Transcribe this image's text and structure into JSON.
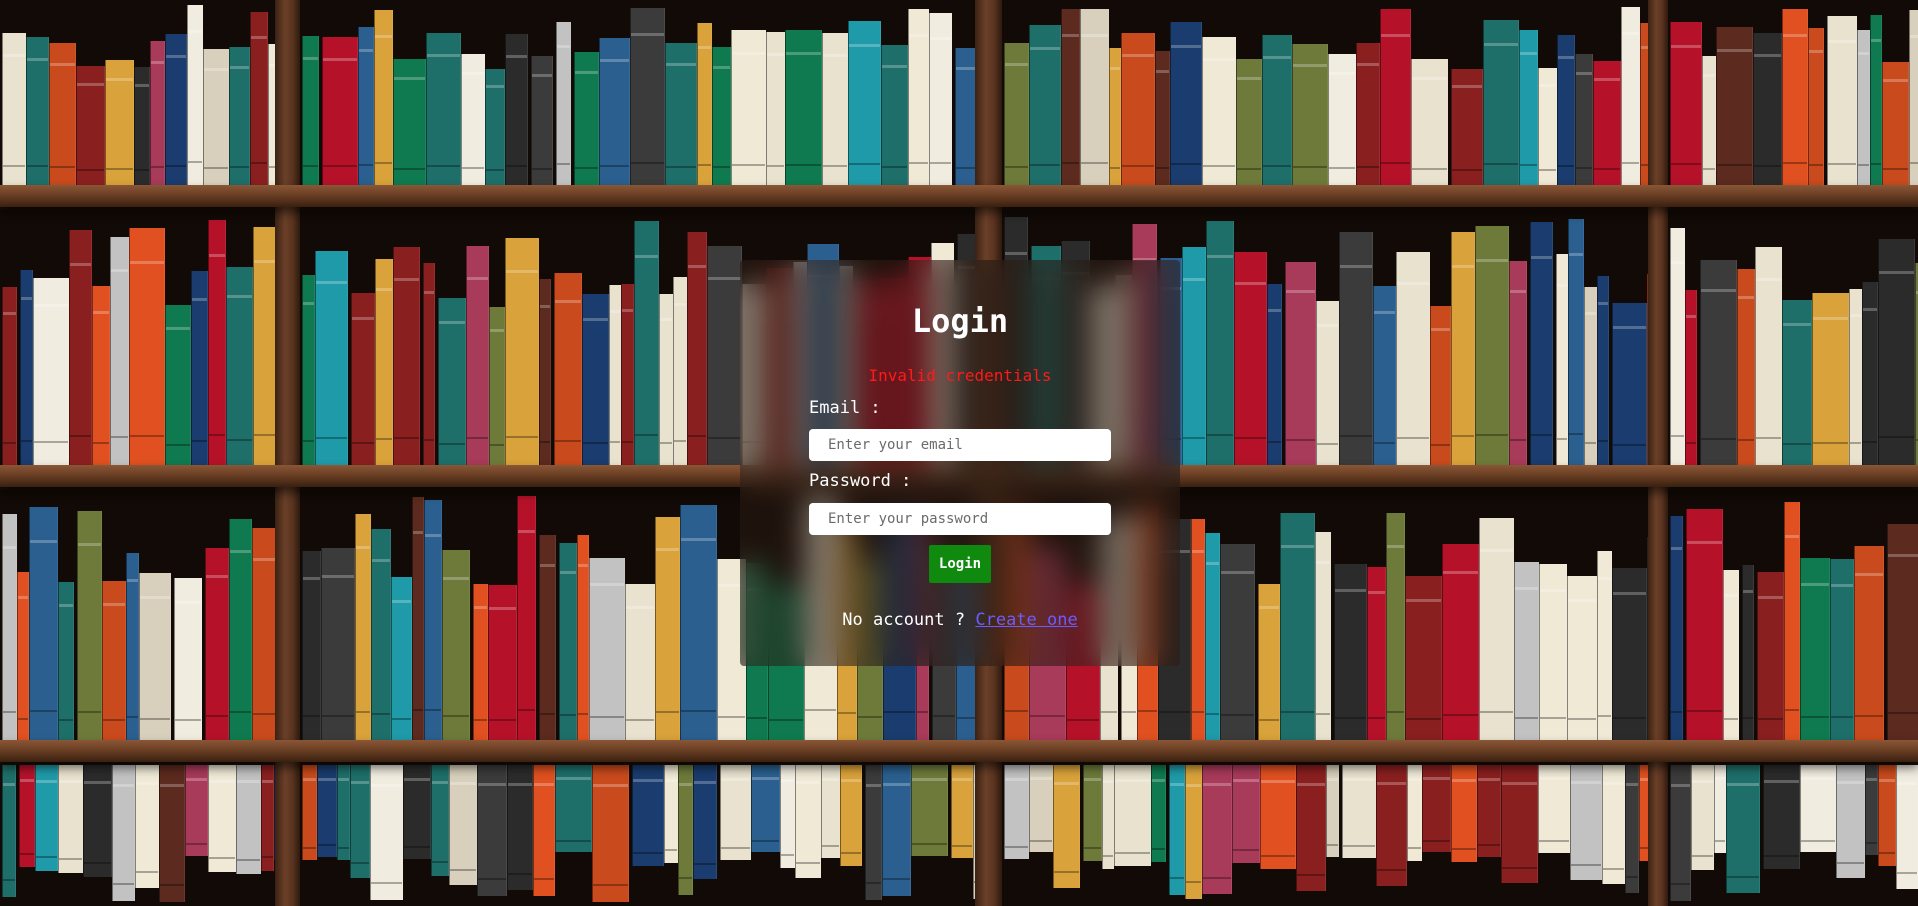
{
  "login": {
    "title": "Login",
    "error_message": "Invalid credentials",
    "email_label": "Email :",
    "email_placeholder": "Enter your email",
    "password_label": "Password :",
    "password_placeholder": "Enter your password",
    "login_button_label": "Login",
    "no_account_text": "No account ?",
    "create_account_link": "Create one"
  },
  "colors": {
    "error": "#ff1a1a",
    "login_button": "#0f8a0f",
    "link": "#6a5cff",
    "shelf_wood": "#6b3f24"
  },
  "background": {
    "description_icon": "bookshelf-image"
  }
}
